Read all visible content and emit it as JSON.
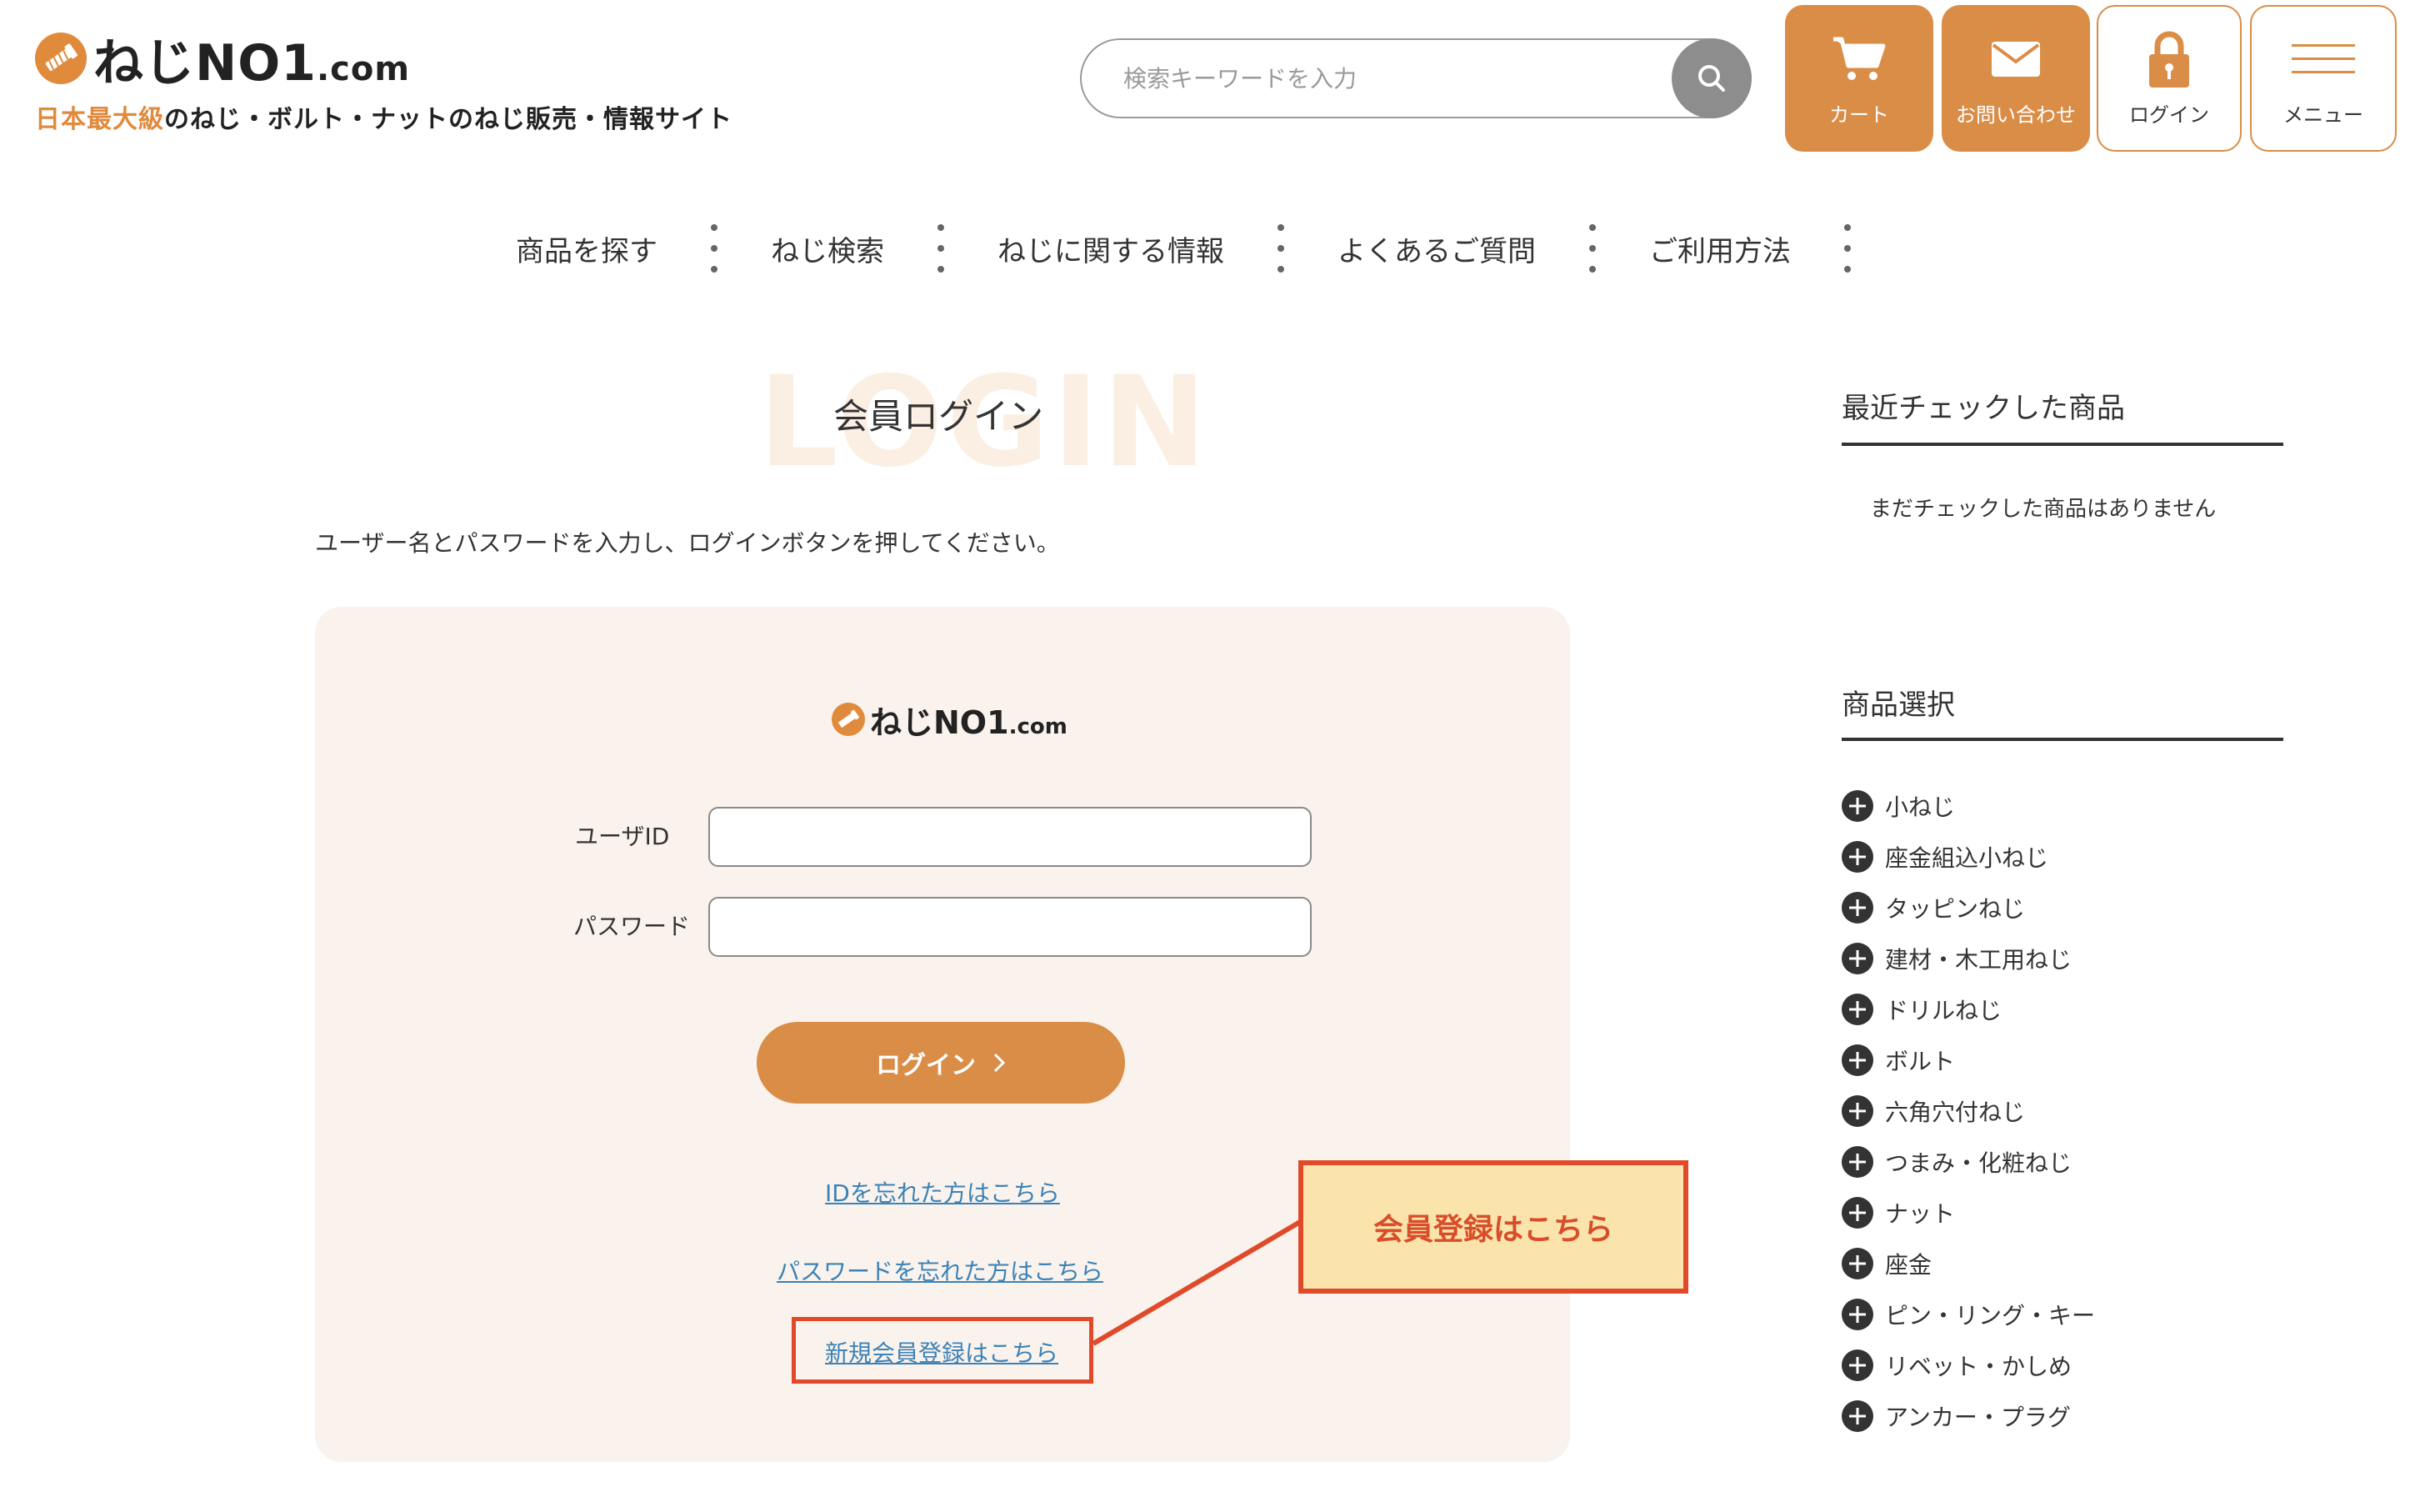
{
  "header": {
    "logo_text": "ねじNO1",
    "logo_suffix": ".com",
    "tagline_accent": "日本最大級",
    "tagline_rest": "のねじ・ボルト・ナットのねじ販売・情報サイト",
    "search_placeholder": "検索キーワードを入力",
    "buttons": {
      "cart": "カート",
      "contact": "お問い合わせ",
      "login": "ログイン",
      "menu": "メニュー"
    },
    "accent_color": "#d98d47"
  },
  "nav": {
    "items": [
      "商品を探す",
      "ねじ検索",
      "ねじに関する情報",
      "よくあるご質問",
      "ご利用方法"
    ]
  },
  "login": {
    "background_word": "LOGIN",
    "title": "会員ログイン",
    "instruction": "ユーザー名とパスワードを入力し、ログインボタンを押してください。",
    "card_logo_text": "ねじNO1",
    "card_logo_suffix": ".com",
    "userid_label": "ユーザID",
    "userid_value": "",
    "password_label": "パスワード",
    "password_value": "",
    "submit_label": "ログイン",
    "forgot_id_link": "IDを忘れた方はこちら",
    "forgot_password_link": "パスワードを忘れた方はこちら",
    "register_link": "新規会員登録はこちら"
  },
  "annotation": {
    "callout_text": "会員登録はこちら",
    "border_color": "#e04a2a",
    "fill_color": "#fbe4ab"
  },
  "sidebar": {
    "recent_title": "最近チェックした商品",
    "recent_empty": "まだチェックした商品はありません",
    "category_title": "商品選択",
    "categories": [
      "小ねじ",
      "座金組込小ねじ",
      "タッピンねじ",
      "建材・木工用ねじ",
      "ドリルねじ",
      "ボルト",
      "六角穴付ねじ",
      "つまみ・化粧ねじ",
      "ナット",
      "座金",
      "ピン・リング・キー",
      "リベット・かしめ",
      "アンカー・プラグ"
    ]
  }
}
